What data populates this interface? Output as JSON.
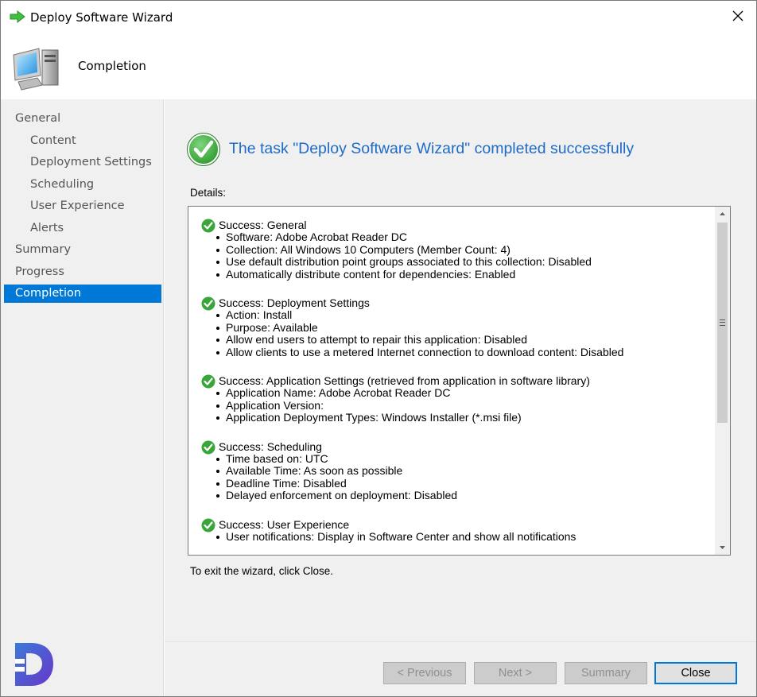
{
  "window": {
    "title": "Deploy Software Wizard",
    "close_icon": "close-icon"
  },
  "header": {
    "title": "Completion",
    "icon": "computer-icon"
  },
  "sidebar": {
    "items": [
      {
        "label": "General",
        "level": "top",
        "active": false
      },
      {
        "label": "Content",
        "level": "sub",
        "active": false
      },
      {
        "label": "Deployment Settings",
        "level": "sub",
        "active": false
      },
      {
        "label": "Scheduling",
        "level": "sub",
        "active": false
      },
      {
        "label": "User Experience",
        "level": "sub",
        "active": false
      },
      {
        "label": "Alerts",
        "level": "sub",
        "active": false
      },
      {
        "label": "Summary",
        "level": "top",
        "active": false
      },
      {
        "label": "Progress",
        "level": "top",
        "active": false
      },
      {
        "label": "Completion",
        "level": "top",
        "active": true
      }
    ],
    "logo_icon": "brand-logo-icon"
  },
  "main": {
    "success_title": "The task \"Deploy Software Wizard\" completed successfully",
    "details_label": "Details:",
    "exit_text": "To exit the wizard, click Close.",
    "sections": [
      {
        "title": "Success: General",
        "items": [
          "Software: Adobe Acrobat Reader DC",
          "Collection: All Windows 10 Computers (Member Count: 4)",
          "Use default distribution point groups associated to this collection: Disabled",
          "Automatically distribute content for dependencies: Enabled"
        ]
      },
      {
        "title": "Success: Deployment Settings",
        "items": [
          "Action: Install",
          "Purpose: Available",
          "Allow end users to attempt to repair this application: Disabled",
          "Allow clients to use a metered Internet connection to download content: Disabled"
        ]
      },
      {
        "title": "Success: Application Settings (retrieved from application in software library)",
        "items": [
          "Application Name: Adobe Acrobat Reader DC",
          "Application Version:",
          "Application Deployment Types: Windows Installer (*.msi file)"
        ]
      },
      {
        "title": "Success: Scheduling",
        "items": [
          "Time based on: UTC",
          "Available Time: As soon as possible",
          "Deadline Time: Disabled",
          "Delayed enforcement on deployment: Disabled"
        ]
      },
      {
        "title": "Success: User Experience",
        "items": [
          "User notifications: Display in Software Center and show all notifications"
        ]
      }
    ]
  },
  "buttons": {
    "previous": "< Previous",
    "next": "Next >",
    "summary": "Summary",
    "close": "Close"
  },
  "colors": {
    "accent": "#0078d7",
    "success_title": "#1e6cc6",
    "success_check": "#3aa63a"
  }
}
